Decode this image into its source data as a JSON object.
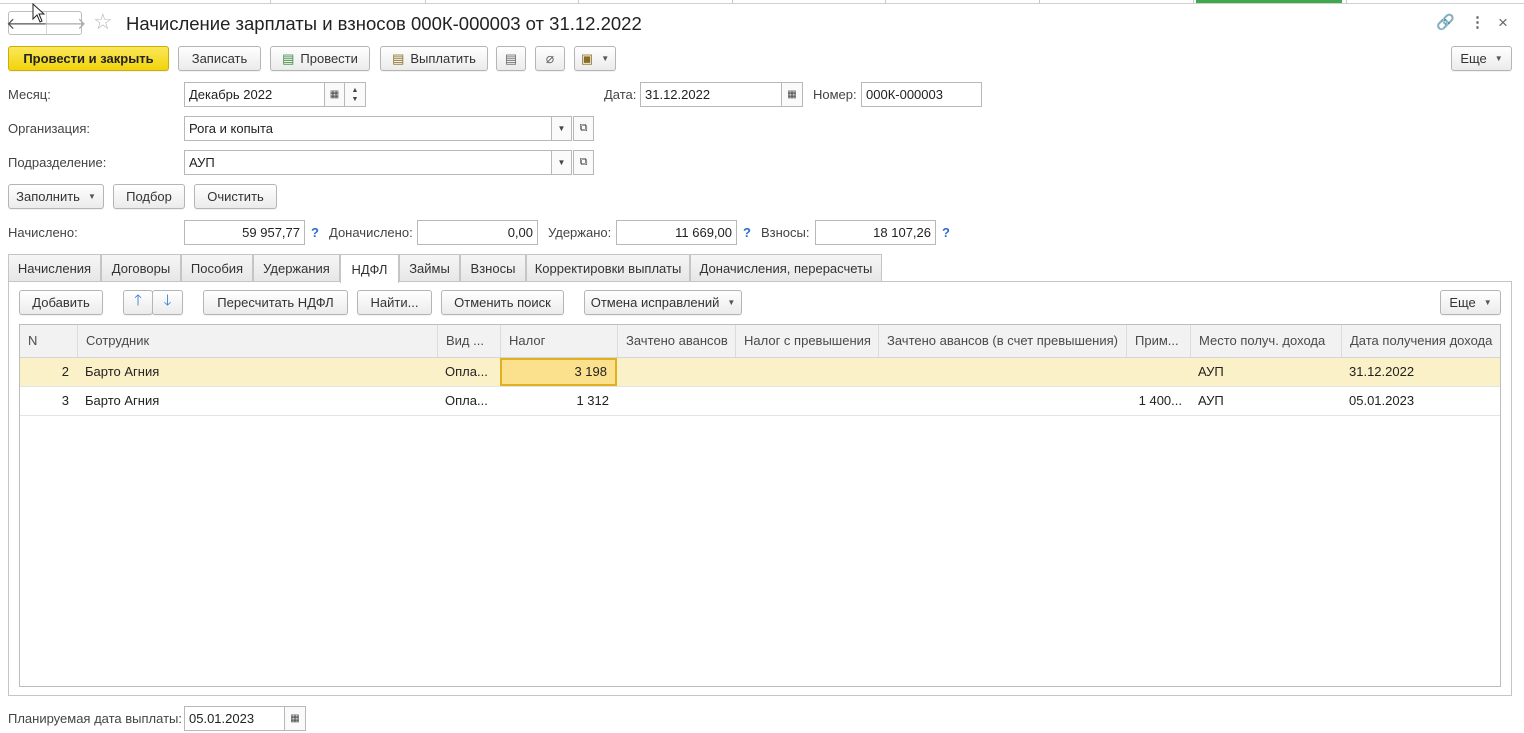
{
  "window": {
    "title": "Начисление зарплаты и взносов 000К-000003 от 31.12.2022",
    "back_glyph": "🡐",
    "forward_glyph": "🡒",
    "star_glyph": "☆",
    "link_glyph": "🔗",
    "menu_glyph": "⋮",
    "close_glyph": "×"
  },
  "toolbar": {
    "post_close": "Провести и закрыть",
    "save": "Записать",
    "post": "Провести",
    "pay": "Выплатить",
    "more": "Еще"
  },
  "header": {
    "month_label": "Месяц:",
    "month_value": "Декабрь 2022",
    "date_label": "Дата:",
    "date_value": "31.12.2022",
    "number_label": "Номер:",
    "number_value": "000К-000003",
    "org_label": "Организация:",
    "org_value": "Рога и копыта",
    "dept_label": "Подразделение:",
    "dept_value": "АУП"
  },
  "actions": {
    "fill": "Заполнить",
    "pick": "Подбор",
    "clear": "Очистить"
  },
  "totals": {
    "accrued_label": "Начислено:",
    "accrued_value": "59 957,77",
    "additional_label": "Доначислено:",
    "additional_value": "0,00",
    "withheld_label": "Удержано:",
    "withheld_value": "11 669,00",
    "contrib_label": "Взносы:",
    "contrib_value": "18 107,26",
    "help_glyph": "?"
  },
  "tabs": [
    {
      "label": "Начисления"
    },
    {
      "label": "Договоры"
    },
    {
      "label": "Пособия"
    },
    {
      "label": "Удержания"
    },
    {
      "label": "НДФЛ"
    },
    {
      "label": "Займы"
    },
    {
      "label": "Взносы"
    },
    {
      "label": "Корректировки выплаты"
    },
    {
      "label": "Доначисления, перерасчеты"
    }
  ],
  "active_tab": "НДФЛ",
  "panel_toolbar": {
    "add": "Добавить",
    "recalc": "Пересчитать НДФЛ",
    "find": "Найти...",
    "cancel_search": "Отменить поиск",
    "cancel_corrections": "Отмена исправлений",
    "more": "Еще"
  },
  "table": {
    "columns": [
      "N",
      "Сотрудник",
      "Вид ...",
      "Налог",
      "Зачтено авансов",
      "Налог с превышения",
      "Зачтено авансов (в счет превышения)",
      "Прим...",
      "Место получ. дохода",
      "Дата получения дохода"
    ],
    "rows": [
      {
        "n": "2",
        "employee": "Барто Агния",
        "kind": "Опла...",
        "tax": "3 198",
        "advances": "",
        "tax_excess": "",
        "advances_excess": "",
        "note": "",
        "place": "АУП",
        "date": "31.12.2022",
        "selected": true
      },
      {
        "n": "3",
        "employee": "Барто Агния",
        "kind": "Опла...",
        "tax": "1 312",
        "advances": "",
        "tax_excess": "",
        "advances_excess": "",
        "note": "1 400...",
        "place": "АУП",
        "date": "05.01.2023",
        "selected": false
      }
    ]
  },
  "footer": {
    "planned_date_label": "Планируемая дата выплаты:",
    "planned_date_value": "05.01.2023"
  }
}
